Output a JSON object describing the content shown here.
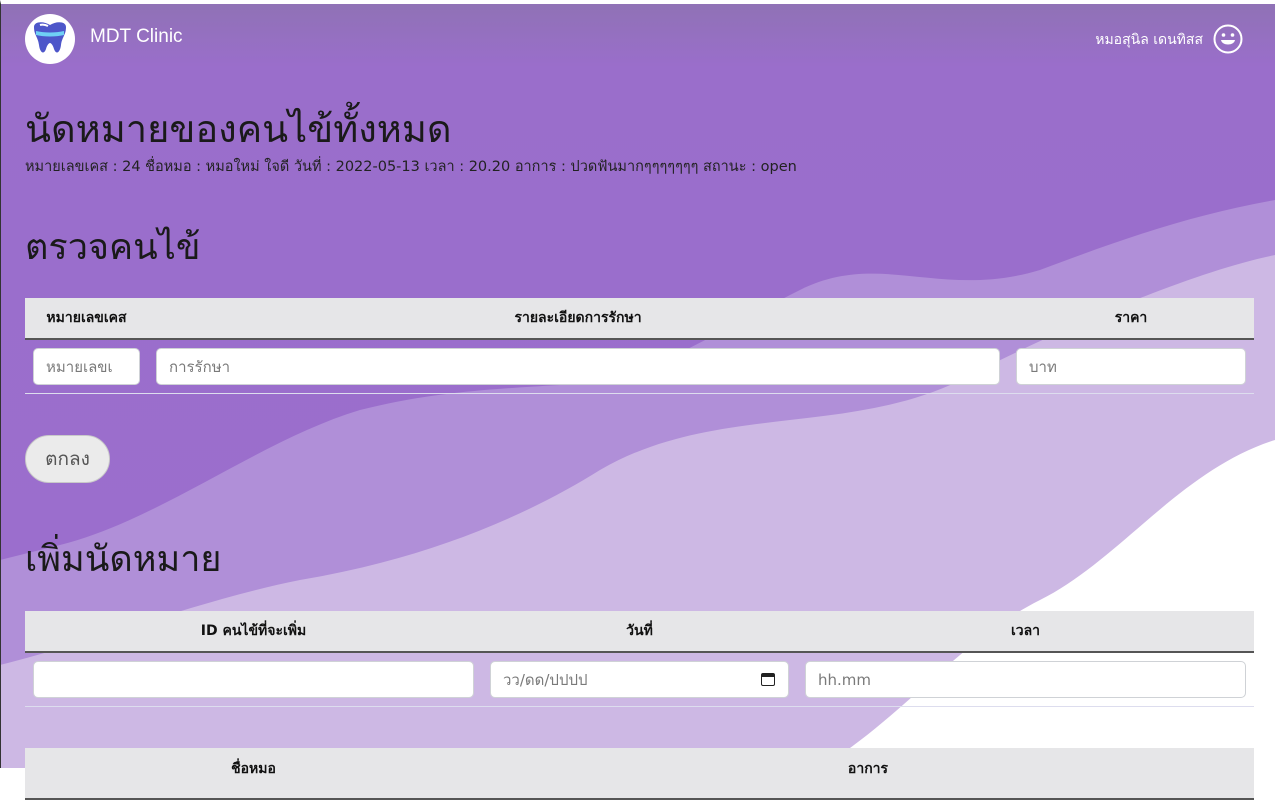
{
  "navbar": {
    "brand": "MDT Clinic",
    "user_name": "หมอสุนิล เดนทิสส",
    "logo_icon": "tooth-logo-icon",
    "avatar_icon": "smiley-avatar-icon"
  },
  "page": {
    "title": "นัดหมายของคนไข้ทั้งหมด",
    "case_info": "หมายเลขเคส : 24 ชื่อหมอ : หมอใหม่ ใจดี วันที่ : 2022-05-13 เวลา : 20.20 อาการ : ปวดฟันมากๆๆๆๆๆๆๆ สถานะ : open"
  },
  "examine": {
    "heading": "ตรวจคนไข้",
    "columns": [
      "หมายเลขเคส",
      "รายละเอียดการรักษา",
      "ราคา"
    ],
    "case_placeholder": "หมายเลขเ",
    "treatment_placeholder": "การรักษา",
    "price_placeholder": "บาท",
    "submit_label": "ตกลง"
  },
  "add_appointment": {
    "heading": "เพิ่มนัดหมาย",
    "columns": [
      "ID คนไข้ที่จะเพิ่ม",
      "วันที่",
      "เวลา"
    ],
    "date_placeholder": "วว/ดด/ปปปป",
    "time_placeholder": "hh.mm"
  },
  "third_table": {
    "columns": [
      "ชื่อหมอ",
      "อาการ"
    ]
  },
  "colors": {
    "purple_dark": "#9a6ecb",
    "purple_light": "#cdb8e4",
    "header_bg": "#e6e6e8"
  }
}
